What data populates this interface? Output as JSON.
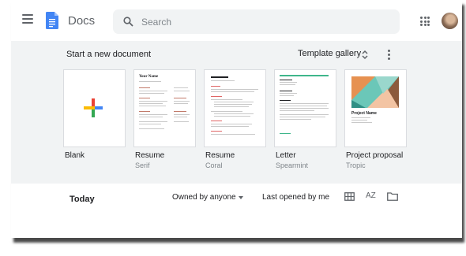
{
  "header": {
    "app_title": "Docs",
    "search_placeholder": "Search"
  },
  "gallery": {
    "title": "Start a new document",
    "template_gallery_label": "Template gallery",
    "templates": [
      {
        "name": "Blank",
        "subtitle": ""
      },
      {
        "name": "Resume",
        "subtitle": "Serif",
        "preview_heading": "Your Name"
      },
      {
        "name": "Resume",
        "subtitle": "Coral"
      },
      {
        "name": "Letter",
        "subtitle": "Spearmint"
      },
      {
        "name": "Project proposal",
        "subtitle": "Tropic",
        "preview_heading": "Project Name"
      }
    ]
  },
  "documents": {
    "section_title": "Today",
    "owner_filter": "Owned by anyone",
    "sort_label": "Last opened by me",
    "sort_icon_text": "AZ"
  },
  "colors": {
    "docs_blue": "#4285f4",
    "gallery_bg": "#f1f3f4",
    "coral": "#e06666",
    "spearmint": "#3fb68b",
    "tropic_teal": "#6bc7b8",
    "tropic_orange": "#e69151"
  },
  "icons": [
    "menu-icon",
    "docs-logo-icon",
    "search-icon",
    "apps-grid-icon",
    "unfold-more-icon",
    "more-vert-icon",
    "google-plus-icon",
    "chevron-down-icon",
    "grid-view-icon",
    "sort-az-icon",
    "folder-icon"
  ]
}
